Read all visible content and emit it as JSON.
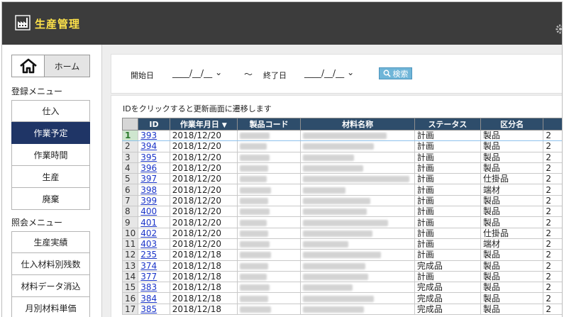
{
  "app": {
    "title": "生産管理",
    "accent_color": "#ffe34a",
    "header_bg": "#3c3c3c"
  },
  "sidebar": {
    "home_label": "ホーム",
    "register_menu_title": "登録メニュー",
    "register_items": [
      {
        "label": "仕入",
        "active": false
      },
      {
        "label": "作業予定",
        "active": true
      },
      {
        "label": "作業時間",
        "active": false
      },
      {
        "label": "生産",
        "active": false
      },
      {
        "label": "廃棄",
        "active": false
      }
    ],
    "inquiry_menu_title": "照会メニュー",
    "inquiry_items": [
      {
        "label": "生産実績"
      },
      {
        "label": "仕入材料別残数"
      },
      {
        "label": "材料データ消込"
      },
      {
        "label": "月別材料単価"
      }
    ],
    "active_color": "#1f3566"
  },
  "search": {
    "start_label": "開始日",
    "start_value": "____/__/__",
    "range_sep": "～",
    "end_label": "終了日",
    "end_value": "____/__/__",
    "button_label": "検索"
  },
  "content": {
    "hint": "IDをクリックすると更新画面に遷移します",
    "columns": [
      "ID",
      "作業年月日",
      "製品コード",
      "材料名称",
      "ステータス",
      "区分名",
      ""
    ],
    "rows": [
      {
        "n": "1",
        "id": "393",
        "date": "2018/12/20",
        "status": "計画",
        "kubun": "製品",
        "extra": "2"
      },
      {
        "n": "2",
        "id": "394",
        "date": "2018/12/20",
        "status": "計画",
        "kubun": "製品",
        "extra": "2"
      },
      {
        "n": "3",
        "id": "395",
        "date": "2018/12/20",
        "status": "計画",
        "kubun": "製品",
        "extra": "2"
      },
      {
        "n": "4",
        "id": "396",
        "date": "2018/12/20",
        "status": "計画",
        "kubun": "製品",
        "extra": "2"
      },
      {
        "n": "5",
        "id": "397",
        "date": "2018/12/20",
        "status": "計画",
        "kubun": "仕掛品",
        "extra": "2"
      },
      {
        "n": "6",
        "id": "398",
        "date": "2018/12/20",
        "status": "計画",
        "kubun": "端材",
        "extra": "2"
      },
      {
        "n": "7",
        "id": "399",
        "date": "2018/12/20",
        "status": "計画",
        "kubun": "製品",
        "extra": "2"
      },
      {
        "n": "8",
        "id": "400",
        "date": "2018/12/20",
        "status": "計画",
        "kubun": "製品",
        "extra": "2"
      },
      {
        "n": "9",
        "id": "401",
        "date": "2018/12/20",
        "status": "計画",
        "kubun": "製品",
        "extra": "2"
      },
      {
        "n": "10",
        "id": "402",
        "date": "2018/12/20",
        "status": "計画",
        "kubun": "仕掛品",
        "extra": "2"
      },
      {
        "n": "11",
        "id": "403",
        "date": "2018/12/20",
        "status": "計画",
        "kubun": "端材",
        "extra": "2"
      },
      {
        "n": "12",
        "id": "235",
        "date": "2018/12/18",
        "status": "計画",
        "kubun": "製品",
        "extra": "2"
      },
      {
        "n": "13",
        "id": "374",
        "date": "2018/12/18",
        "status": "完成品",
        "kubun": "製品",
        "extra": "2"
      },
      {
        "n": "14",
        "id": "377",
        "date": "2018/12/18",
        "status": "計画",
        "kubun": "製品",
        "extra": "2"
      },
      {
        "n": "15",
        "id": "383",
        "date": "2018/12/18",
        "status": "完成品",
        "kubun": "製品",
        "extra": "2"
      },
      {
        "n": "16",
        "id": "384",
        "date": "2018/12/18",
        "status": "完成品",
        "kubun": "製品",
        "extra": "2"
      },
      {
        "n": "17",
        "id": "385",
        "date": "2018/12/18",
        "status": "完成品",
        "kubun": "製品",
        "extra": "2"
      }
    ]
  }
}
